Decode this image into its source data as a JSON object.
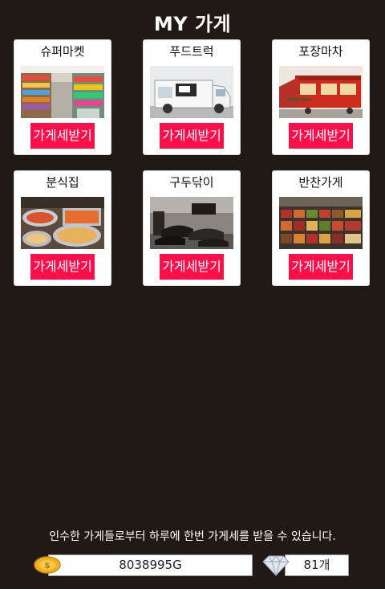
{
  "page": {
    "title": "MY 가게"
  },
  "stores": [
    {
      "name": "슈퍼마켓",
      "button_label": "가게세받기",
      "thumbnail": "supermarket-photo"
    },
    {
      "name": "푸드트럭",
      "button_label": "가게세받기",
      "thumbnail": "food-truck-photo"
    },
    {
      "name": "포장마차",
      "button_label": "가게세받기",
      "thumbnail": "street-stall-photo"
    },
    {
      "name": "분식집",
      "button_label": "가게세받기",
      "thumbnail": "snack-bar-photo"
    },
    {
      "name": "구두닦이",
      "button_label": "가게세받기",
      "thumbnail": "shoe-shine-photo"
    },
    {
      "name": "반찬가게",
      "button_label": "가게세받기",
      "thumbnail": "side-dish-shop-photo"
    }
  ],
  "footer": {
    "info": "인수한 가게들로부터 하루에 한번 가게세를 받을 수 있습니다.",
    "gold": "8038995G",
    "gems": "81개"
  },
  "colors": {
    "background": "#211915",
    "button": "#ff0f4a",
    "card": "#ffffff"
  },
  "icons": {
    "gold": "coin-icon",
    "gems": "diamond-icon"
  }
}
